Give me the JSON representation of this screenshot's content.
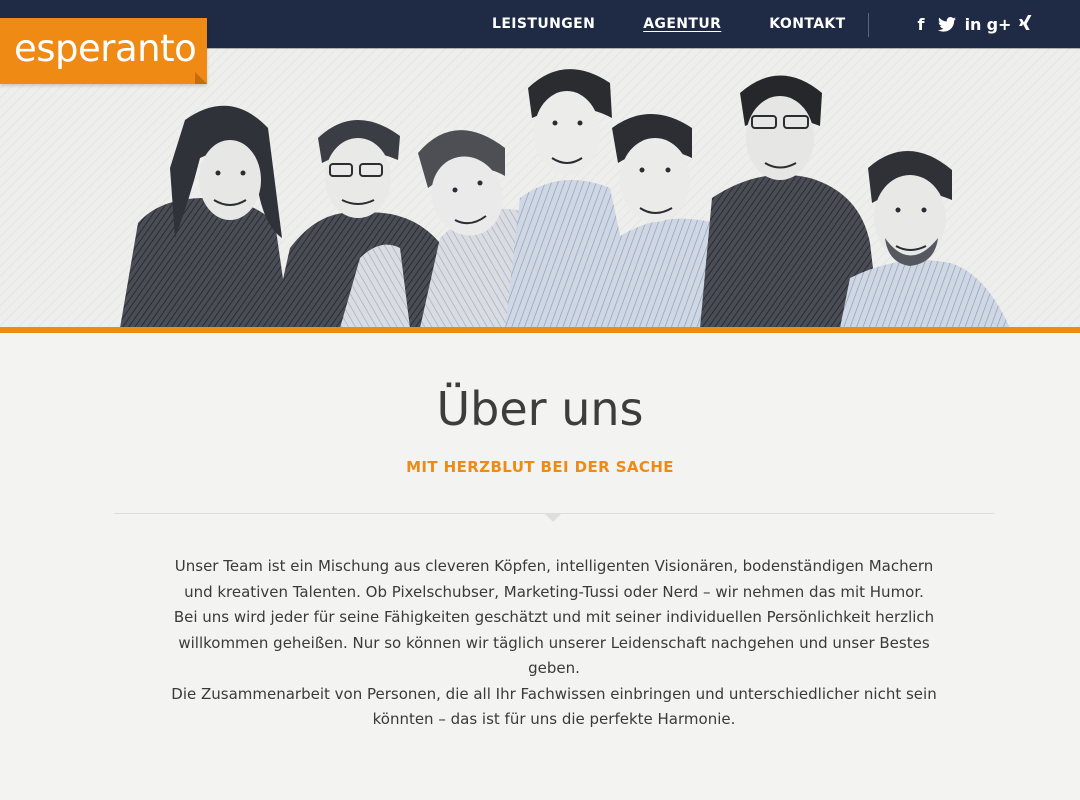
{
  "logo": {
    "text": "esperanto"
  },
  "nav": {
    "items": [
      {
        "label": "LEISTUNGEN"
      },
      {
        "label": "AGENTUR"
      },
      {
        "label": "KONTAKT"
      }
    ]
  },
  "social": [
    {
      "icon": "facebook-icon",
      "glyph": "f"
    },
    {
      "icon": "twitter-icon"
    },
    {
      "icon": "linkedin-icon",
      "glyph": "in"
    },
    {
      "icon": "google-plus-icon",
      "glyph": "g+"
    },
    {
      "icon": "xing-icon"
    }
  ],
  "colors": {
    "accent": "#ef8a14",
    "nav_bg": "#1f2b45",
    "text": "#3a3a3a"
  },
  "hero": {
    "image": "team-illustration"
  },
  "main": {
    "title": "Über uns",
    "subtitle": "MIT HERZBLUT BEI DER SACHE",
    "paragraph1": "Unser Team ist ein Mischung aus cleveren Köpfen, intelligenten Visionären, bodenständigen Machern und kreativen Talenten. Ob Pixelschubser, Marketing-Tussi oder Nerd – wir nehmen das mit Humor. Bei uns wird jeder für seine Fähigkeiten geschätzt und mit seiner individuellen Persönlichkeit herzlich willkommen geheißen. Nur so können wir täglich unserer Leidenschaft nachgehen und unser Bestes geben.",
    "paragraph2": "Die Zusammenarbeit von Personen, die all Ihr Fachwissen einbringen und unterschiedlicher nicht sein könnten – das ist für uns die perfekte Harmonie."
  }
}
